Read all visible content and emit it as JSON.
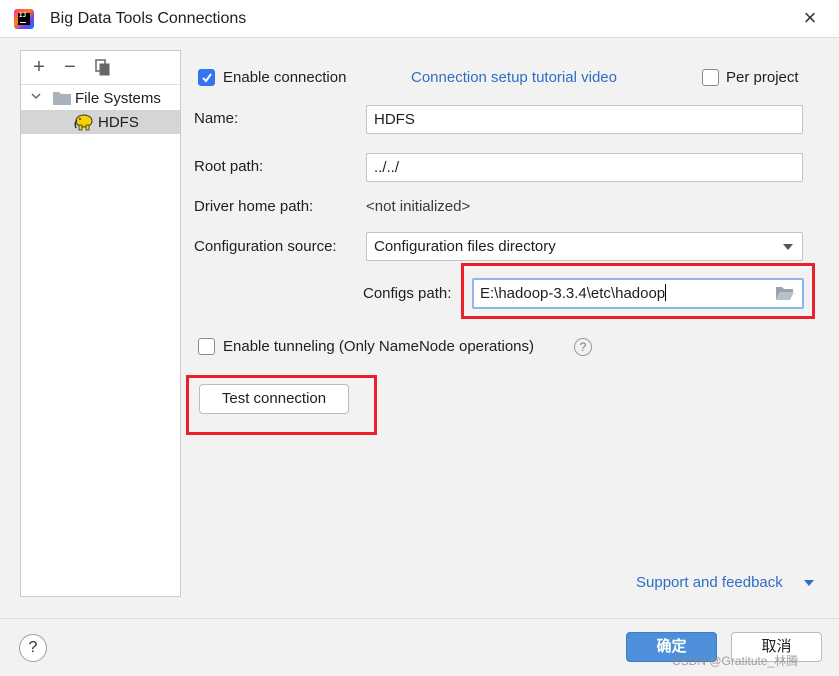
{
  "window": {
    "title": "Big Data Tools Connections",
    "close_symbol": "×"
  },
  "sidebar": {
    "toolbar": {
      "add_symbol": "+",
      "remove_symbol": "−"
    },
    "tree": [
      {
        "label": "File Systems",
        "expanded": true,
        "icon": "folder-icon"
      },
      {
        "label": "HDFS",
        "selected": true,
        "icon": "hadoop-elephant-icon"
      }
    ]
  },
  "form": {
    "enable_connection": {
      "label": "Enable connection",
      "checked": true
    },
    "tutorial_link": "Connection setup tutorial video",
    "per_project": {
      "label": "Per project",
      "checked": false
    },
    "name": {
      "label": "Name:",
      "value": "HDFS"
    },
    "root_path": {
      "label": "Root path:",
      "value": "../../"
    },
    "driver_home": {
      "label": "Driver home path:",
      "value": "<not initialized>"
    },
    "config_source": {
      "label": "Configuration source:",
      "value": "Configuration files directory"
    },
    "configs_path": {
      "label": "Configs path:",
      "value": "E:\\hadoop-3.3.4\\etc\\hadoop"
    },
    "enable_tunneling": {
      "label": "Enable tunneling (Only NameNode operations)",
      "checked": false
    },
    "help_symbol": "?",
    "test_connection": "Test connection",
    "support_link": "Support and feedback"
  },
  "footer": {
    "help_symbol": "?",
    "ok_label": "确定",
    "cancel_label": "取消",
    "watermark": "CSDN @Gratitute_林腾"
  },
  "colors": {
    "accent": "#3574f0",
    "link": "#2f6ec2",
    "highlight_box": "#e8212b",
    "primary_button": "#4d8fd9"
  }
}
